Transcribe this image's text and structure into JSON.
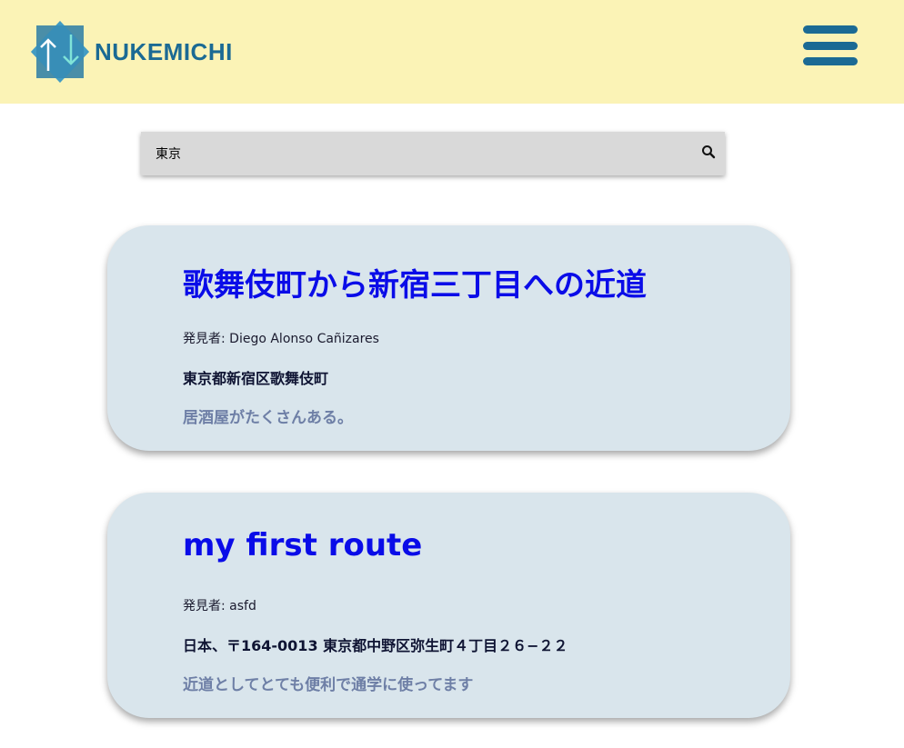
{
  "header": {
    "logo_text": "NUKEMICHI",
    "menu_icon": "hamburger-menu-icon",
    "colors": {
      "background": "#fbf3b6",
      "brand": "#1b6a94",
      "brand_light": "#3a9bbf"
    }
  },
  "search": {
    "value": "東京",
    "placeholder": "",
    "icon": "search-icon"
  },
  "routes": [
    {
      "title": "歌舞伎町から新宿三丁目への近道",
      "finder_label": "発見者: Diego Alonso Cañizares",
      "address": "東京都新宿区歌舞伎町",
      "description": "居酒屋がたくさんある。"
    },
    {
      "title": "my first route",
      "finder_label": "発見者: asfd",
      "address": "日本、〒164-0013 東京都中野区弥生町４丁目２６−２２",
      "description": "近道としてとても便利で通学に使ってます"
    }
  ],
  "colors": {
    "card_background": "#d9e5ec",
    "title_link": "#0a0ce8",
    "description": "#6e7fa6"
  }
}
